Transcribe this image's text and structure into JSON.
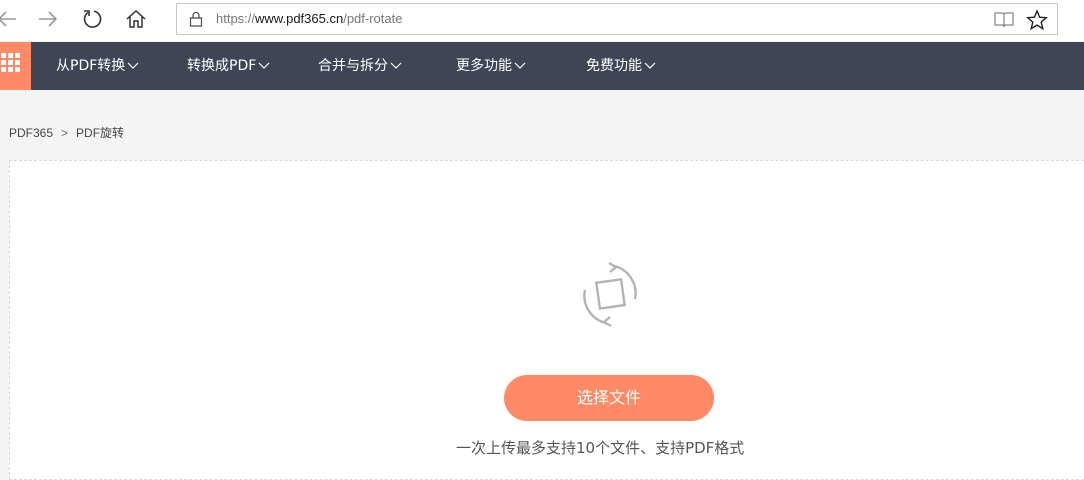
{
  "browser": {
    "url_prefix": "https://",
    "url_host": "www.pdf365.cn",
    "url_path": "/pdf-rotate",
    "icons": [
      "back-arrow-icon",
      "forward-arrow-icon",
      "refresh-icon",
      "home-icon",
      "lock-icon",
      "reading-view-icon",
      "star-icon"
    ]
  },
  "nav": {
    "brand_color": "#ff8a65",
    "background": "#3f4555",
    "items": [
      {
        "label": "从PDF转换"
      },
      {
        "label": "转换成PDF"
      },
      {
        "label": "合并与拆分"
      },
      {
        "label": "更多功能"
      },
      {
        "label": "免费功能"
      }
    ]
  },
  "breadcrumb": {
    "home": "PDF365",
    "separator": ">",
    "current": "PDF旋转"
  },
  "upload": {
    "icon": "rotate-icon",
    "button_label": "选择文件",
    "hint": "一次上传最多支持10个文件、支持PDF格式"
  }
}
